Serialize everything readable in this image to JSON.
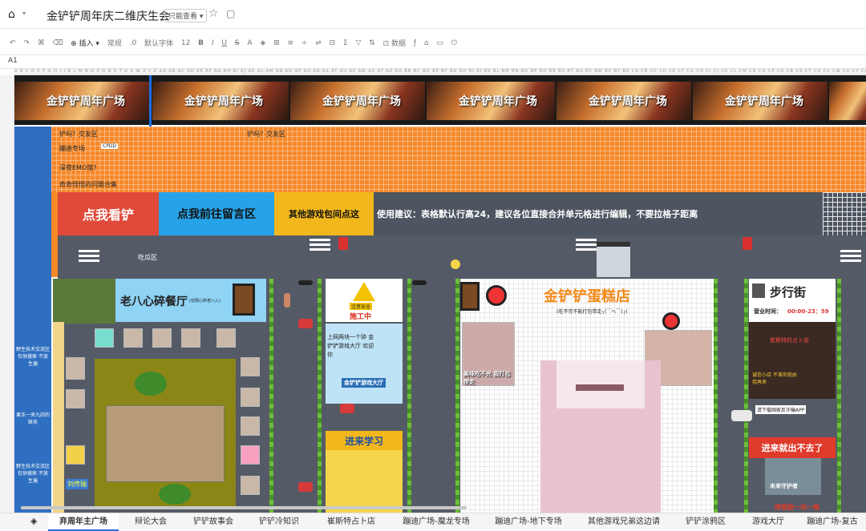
{
  "app": {
    "title": "金铲铲周年庆二维庆生会",
    "permission": "只能查看 ▾"
  },
  "toolbar": {
    "insert": "插入",
    "format": "常规",
    "decimal": ".0",
    "font": "默认字体",
    "size": "12",
    "bold": "B",
    "italic": "I",
    "underline": "U",
    "strike": "S",
    "text_color": "A",
    "sum": "Σ",
    "filter": "▽",
    "data": "数据"
  },
  "formula": {
    "cell": "A1"
  },
  "sheet": {
    "banner_text": "金铲铲周年广场",
    "jiaoyou_title": "铲吗？交友区",
    "jiaoyou_title2": "铲吗？交友区",
    "left_items": [
      "蹦迪专场",
      "深夜EMO馆?",
      "奇奇怪怪的问题合集"
    ],
    "cpdd": "CPDD",
    "btn_watch": "点我看铲",
    "btn_message": "点我前往留言区",
    "btn_games": "其他游戏包间点这",
    "usage": "使用建议：表格默认行高24，建议各位直接合并单元格进行编辑，不要拉格子距离",
    "eat_label": "吃瓜区",
    "restaurant": "老八心碎餐厅",
    "restaurant_sub": "(仅限心碎老八入)",
    "side_labels": [
      "野生技术交流区 仅供搜索 不放生遍",
      "果冻一来九四的联系",
      "野生技术交流区 仅供搜索 不放生遍"
    ],
    "warning": "注意安全",
    "construction": "施工中",
    "hall_text": "上网两块一个钟 金铲铲游戏大厅 欢迎你",
    "hall_sign": "金铲铲游戏大厅",
    "learn": "进来学习",
    "cake_title": "金铲铲蛋糕店",
    "cake_sub": "(吃不完不能打包带走┐(￣ヘ￣)┌)",
    "cake_photo_text": "美味吃不完 我打包带走",
    "street_title": "步行街",
    "hours_label": "营业时间：",
    "hours": "00:00-23：59",
    "fortune": "崔斯特的占卜店",
    "fortune_sub": "诚信小店 不准你就由我再来",
    "app_note": "请下载国家反诈骗APP",
    "no_exit": "进来就出不去了",
    "guard": "未来守护者",
    "sausage": "烤香肠一块一根",
    "liuchuan": "刘传瑞"
  },
  "tabs": [
    "弃周年主广场",
    "辩论大会",
    "铲铲故事会",
    "铲铲冷知识",
    "崔斯特占卜店",
    "蹦迪广场-魔龙专场",
    "蹦迪广场-地下专场",
    "其他游戏兄弟这边请",
    "铲铲涂鸦区",
    "游戏大厅",
    "蹦迪广场-复古"
  ]
}
